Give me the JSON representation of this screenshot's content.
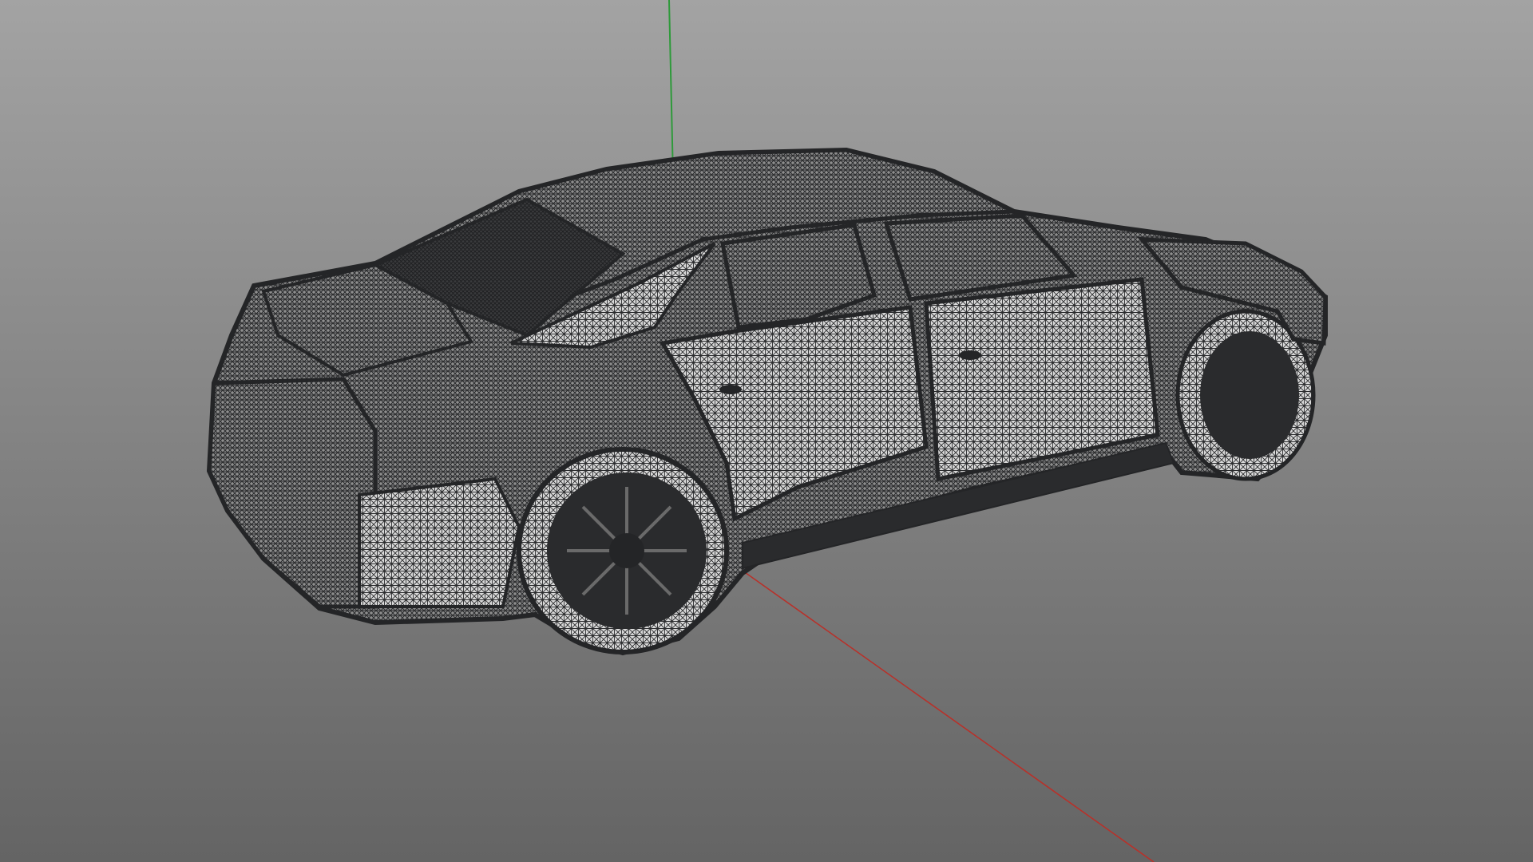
{
  "viewport": {
    "background_top": "#a3a3a3",
    "background_bottom": "#646464"
  },
  "axes": {
    "y_axis_color": "#2e9a3a",
    "x_axis_color": "#b8312a"
  },
  "model": {
    "object": "car",
    "render_mode": "wireframe",
    "wire_color": "#2a2b2d",
    "face_color": "#d8d8d8"
  }
}
